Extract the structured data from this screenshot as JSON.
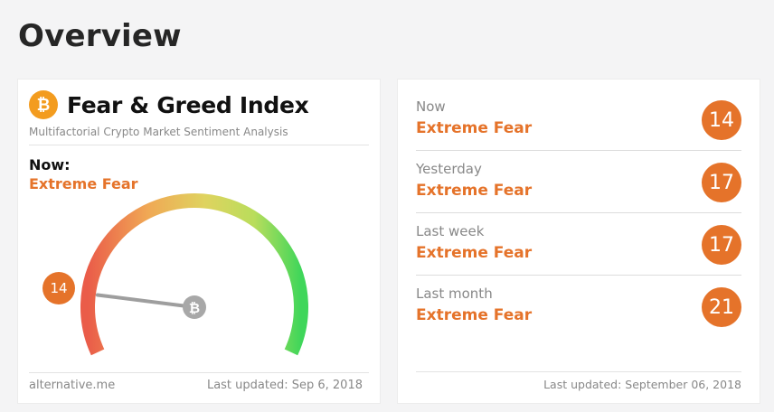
{
  "page": {
    "title": "Overview"
  },
  "fng_card": {
    "badge_icon": "bitcoin-icon",
    "badge_glyph": "₿",
    "title": "Fear & Greed Index",
    "subtitle": "Multifactorial Crypto Market Sentiment Analysis",
    "now_label": "Now:",
    "classification": "Extreme Fear",
    "value": "14",
    "value_fraction": 0.14,
    "needle_hub_icon": "bitcoin-icon",
    "needle_hub_glyph": "₿",
    "source": "alternative.me",
    "last_updated": "Last updated: Sep 6, 2018"
  },
  "history_card": {
    "rows": [
      {
        "label": "Now",
        "classification": "Extreme Fear",
        "value": "14"
      },
      {
        "label": "Yesterday",
        "classification": "Extreme Fear",
        "value": "17"
      },
      {
        "label": "Last week",
        "classification": "Extreme Fear",
        "value": "17"
      },
      {
        "label": "Last month",
        "classification": "Extreme Fear",
        "value": "21"
      }
    ],
    "last_updated": "Last updated: September 06, 2018"
  },
  "colors": {
    "accent": "#e5732a",
    "bitcoin": "#f39c1f",
    "gauge_start": "#ea5c49",
    "gauge_mid": "#dfd35f",
    "gauge_end": "#3fd65a"
  }
}
